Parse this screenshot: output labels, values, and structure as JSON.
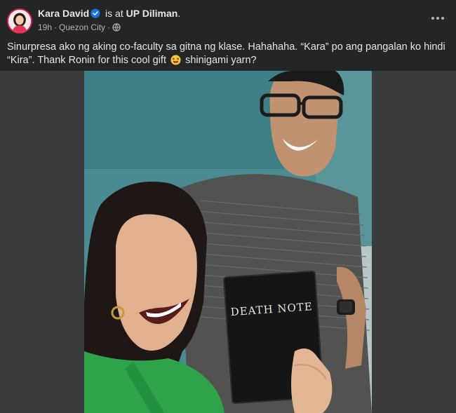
{
  "post": {
    "author": "Kara David",
    "is_at": "is at",
    "location": "UP Diliman",
    "location_suffix": ".",
    "time": "19h",
    "dot1": "·",
    "city": "Quezon City",
    "dot2": "·",
    "caption_part1": "Sinurpresa ako ng aking co-faculty sa gitna ng klase. Hahahaha. “Kara” po ang pangalan ko hindi “Kira”. Thank Ronin for this cool gift",
    "caption_part2": "shinigami yarn?",
    "emoji": "grinning-squinting-tongue-emoji",
    "photo_text": "DEATH NOTE"
  },
  "icons": {
    "verified": "verified-badge-icon",
    "privacy": "globe-icon",
    "more": "more-options-icon"
  },
  "colors": {
    "background": "#242526",
    "media_background": "#3a3b3c",
    "text_primary": "#e4e6eb",
    "text_secondary": "#b0b3b8",
    "verified_blue": "#1b74e4",
    "avatar_ring": "#d6204e"
  }
}
